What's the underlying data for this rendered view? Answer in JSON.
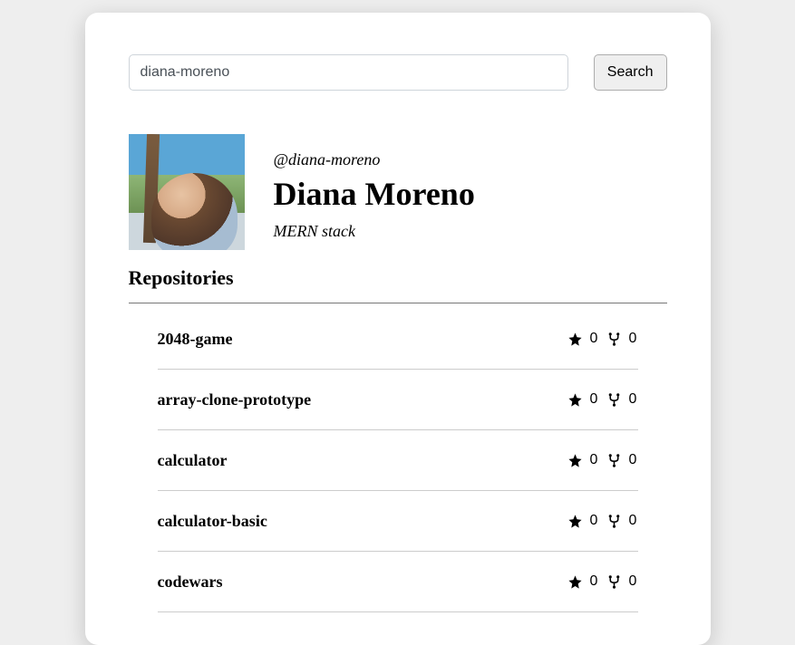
{
  "search": {
    "value": "diana-moreno",
    "button_label": "Search"
  },
  "profile": {
    "handle": "@diana-moreno",
    "display_name": "Diana Moreno",
    "bio": "MERN stack"
  },
  "repos_heading": "Repositories",
  "repos": [
    {
      "name": "2048-game",
      "stars": 0,
      "forks": 0
    },
    {
      "name": "array-clone-prototype",
      "stars": 0,
      "forks": 0
    },
    {
      "name": "calculator",
      "stars": 0,
      "forks": 0
    },
    {
      "name": "calculator-basic",
      "stars": 0,
      "forks": 0
    },
    {
      "name": "codewars",
      "stars": 0,
      "forks": 0
    }
  ]
}
